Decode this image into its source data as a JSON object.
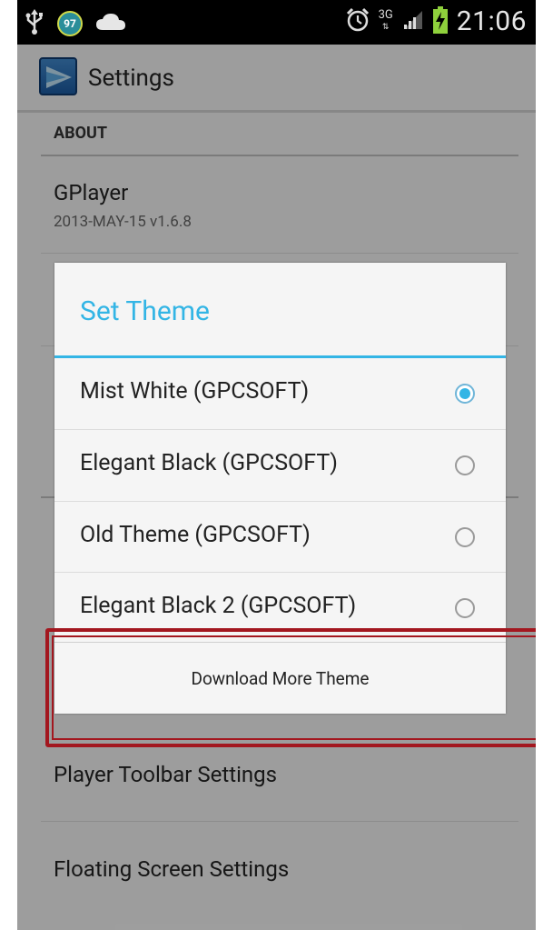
{
  "status_bar": {
    "notification_badge": "97",
    "network": "3G",
    "time": "21:06",
    "icons": [
      "usb-icon",
      "cloud-icon",
      "alarm-icon",
      "signal-icon",
      "battery-charging-icon"
    ]
  },
  "action_bar": {
    "title": "Settings"
  },
  "settings": {
    "section_header": "ABOUT",
    "items": [
      {
        "title": "GPlayer",
        "subtitle": "2013-MAY-15 v1.6.8"
      },
      {
        "title": "Player Toolbar Settings"
      },
      {
        "title": "Floating Screen Settings"
      }
    ]
  },
  "dialog": {
    "title": "Set Theme",
    "options": [
      {
        "label": "Mist White (GPCSOFT)",
        "selected": true
      },
      {
        "label": "Elegant Black (GPCSOFT)",
        "selected": false
      },
      {
        "label": "Old Theme (GPCSOFT)",
        "selected": false
      },
      {
        "label": "Elegant Black 2 (GPCSOFT)",
        "selected": false
      }
    ],
    "button_label": "Download More Theme"
  },
  "colors": {
    "accent": "#33b5e5",
    "highlight": "#a3171f"
  }
}
